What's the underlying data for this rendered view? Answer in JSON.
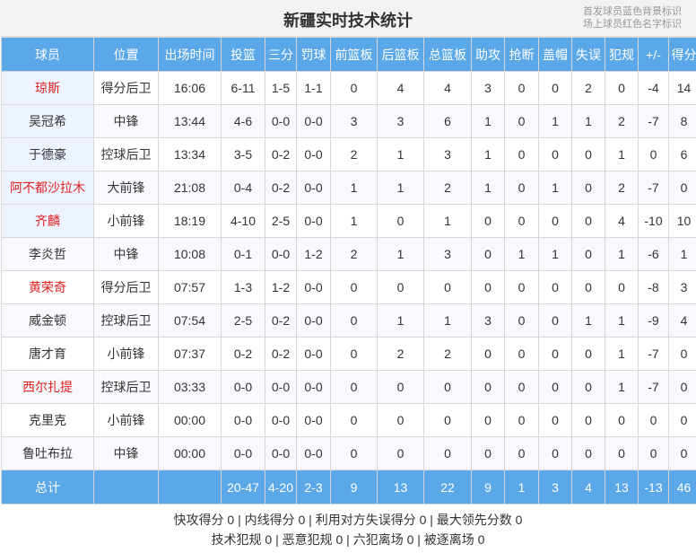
{
  "title": "新疆实时技术统计",
  "legend": {
    "line1": "首发球员蓝色背景标识",
    "line2": "场上球员红色名字标识"
  },
  "headers": [
    "球员",
    "位置",
    "出场时间",
    "投篮",
    "三分",
    "罚球",
    "前篮板",
    "后篮板",
    "总篮板",
    "助攻",
    "抢断",
    "盖帽",
    "失误",
    "犯规",
    "+/-",
    "得分"
  ],
  "players": [
    {
      "name": "琼斯",
      "starter": true,
      "oncourt": true,
      "cells": [
        "得分后卫",
        "16:06",
        "6-11",
        "1-5",
        "1-1",
        "0",
        "4",
        "4",
        "3",
        "0",
        "0",
        "2",
        "0",
        "-4",
        "14"
      ]
    },
    {
      "name": "吴冠希",
      "starter": true,
      "oncourt": false,
      "cells": [
        "中锋",
        "13:44",
        "4-6",
        "0-0",
        "0-0",
        "3",
        "3",
        "6",
        "1",
        "0",
        "1",
        "1",
        "2",
        "-7",
        "8"
      ]
    },
    {
      "name": "于德豪",
      "starter": true,
      "oncourt": false,
      "cells": [
        "控球后卫",
        "13:34",
        "3-5",
        "0-2",
        "0-0",
        "2",
        "1",
        "3",
        "1",
        "0",
        "0",
        "0",
        "1",
        "0",
        "6"
      ]
    },
    {
      "name": "阿不都沙拉木",
      "starter": true,
      "oncourt": true,
      "cells": [
        "大前锋",
        "21:08",
        "0-4",
        "0-2",
        "0-0",
        "1",
        "1",
        "2",
        "1",
        "0",
        "1",
        "0",
        "2",
        "-7",
        "0"
      ]
    },
    {
      "name": "齐麟",
      "starter": true,
      "oncourt": true,
      "cells": [
        "小前锋",
        "18:19",
        "4-10",
        "2-5",
        "0-0",
        "1",
        "0",
        "1",
        "0",
        "0",
        "0",
        "0",
        "4",
        "-10",
        "10"
      ]
    },
    {
      "name": "李炎哲",
      "starter": false,
      "oncourt": false,
      "cells": [
        "中锋",
        "10:08",
        "0-1",
        "0-0",
        "1-2",
        "2",
        "1",
        "3",
        "0",
        "1",
        "1",
        "0",
        "1",
        "-6",
        "1"
      ]
    },
    {
      "name": "黄荣奇",
      "starter": false,
      "oncourt": true,
      "cells": [
        "得分后卫",
        "07:57",
        "1-3",
        "1-2",
        "0-0",
        "0",
        "0",
        "0",
        "0",
        "0",
        "0",
        "0",
        "0",
        "-8",
        "3"
      ]
    },
    {
      "name": "威金顿",
      "starter": false,
      "oncourt": false,
      "cells": [
        "控球后卫",
        "07:54",
        "2-5",
        "0-2",
        "0-0",
        "0",
        "1",
        "1",
        "3",
        "0",
        "0",
        "1",
        "1",
        "-9",
        "4"
      ]
    },
    {
      "name": "唐才育",
      "starter": false,
      "oncourt": false,
      "cells": [
        "小前锋",
        "07:37",
        "0-2",
        "0-2",
        "0-0",
        "0",
        "2",
        "2",
        "0",
        "0",
        "0",
        "0",
        "1",
        "-7",
        "0"
      ]
    },
    {
      "name": "西尔扎提",
      "starter": false,
      "oncourt": true,
      "cells": [
        "控球后卫",
        "03:33",
        "0-0",
        "0-0",
        "0-0",
        "0",
        "0",
        "0",
        "0",
        "0",
        "0",
        "0",
        "1",
        "-7",
        "0"
      ]
    },
    {
      "name": "克里克",
      "starter": false,
      "oncourt": false,
      "cells": [
        "小前锋",
        "00:00",
        "0-0",
        "0-0",
        "0-0",
        "0",
        "0",
        "0",
        "0",
        "0",
        "0",
        "0",
        "0",
        "0",
        "0"
      ]
    },
    {
      "name": "鲁吐布拉",
      "starter": false,
      "oncourt": false,
      "cells": [
        "中锋",
        "00:00",
        "0-0",
        "0-0",
        "0-0",
        "0",
        "0",
        "0",
        "0",
        "0",
        "0",
        "0",
        "0",
        "0",
        "0"
      ]
    }
  ],
  "totals": {
    "label": "总计",
    "cells": [
      "",
      "",
      "20-47",
      "4-20",
      "2-3",
      "9",
      "13",
      "22",
      "9",
      "1",
      "3",
      "4",
      "13",
      "-13",
      "46"
    ]
  },
  "footer": {
    "line1": "快攻得分 0 | 内线得分 0 | 利用对方失误得分 0 | 最大领先分数 0",
    "line2": "技术犯规 0 | 恶意犯规 0 | 六犯离场 0 | 被逐离场 0"
  }
}
